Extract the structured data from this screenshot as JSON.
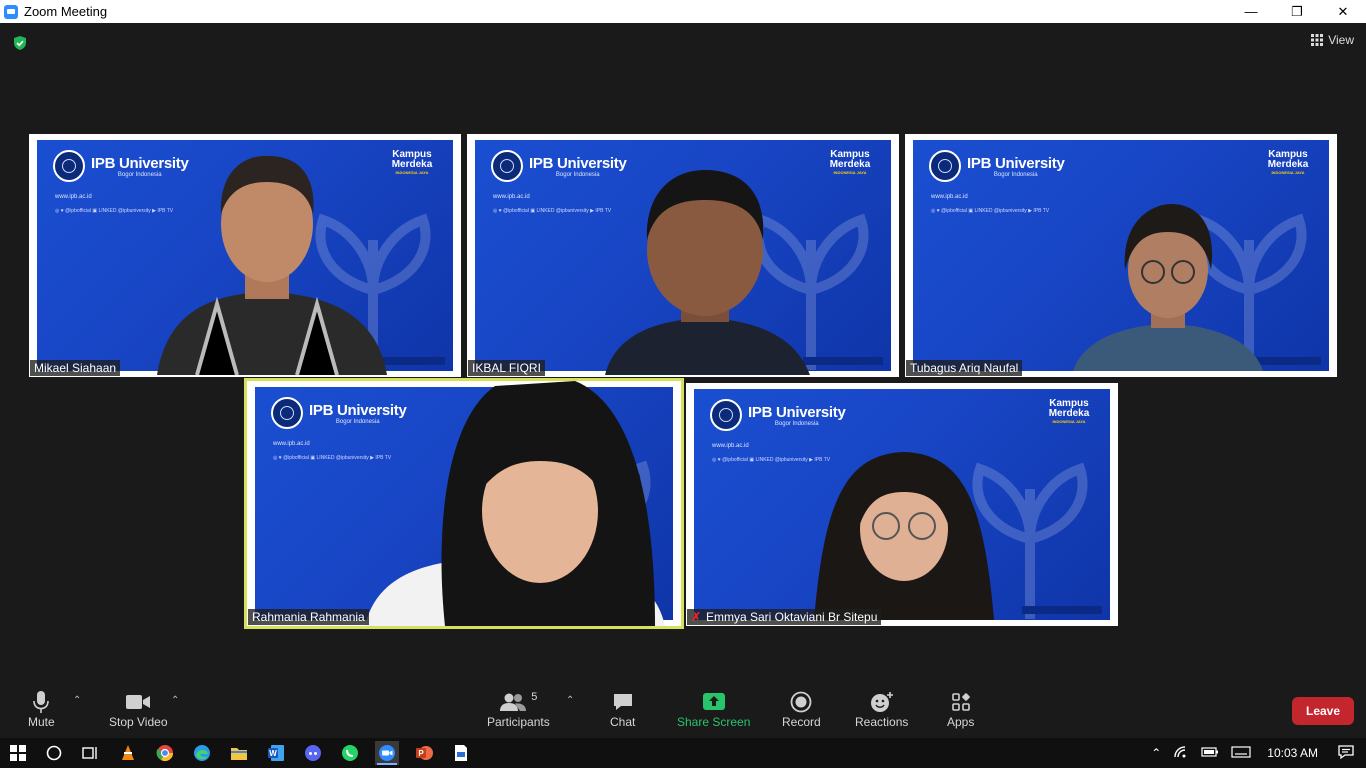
{
  "window": {
    "title": "Zoom Meeting",
    "minimize": "—",
    "restore": "❐",
    "close": "✕"
  },
  "header": {
    "view_label": "View"
  },
  "banner": {
    "university": "IPB University",
    "location": "Bogor Indonesia",
    "website": "www.ipb.ac.id",
    "socials": "◎ ♥ @ipbofficial   ▣ LINKED   @ipbuniversity   ▶ IPB TV",
    "kampus_line1": "Kampus",
    "kampus_line2": "Merdeka",
    "kampus_sub": "INDONESIA JAYA"
  },
  "participants": [
    {
      "name": "Mikael Siahaan",
      "muted": false,
      "active": false
    },
    {
      "name": "IKBAL FIQRI",
      "muted": false,
      "active": false
    },
    {
      "name": "Tubagus Ariq Naufal",
      "muted": false,
      "active": false
    },
    {
      "name": "Rahmania Rahmania",
      "muted": false,
      "active": true
    },
    {
      "name": "Emmya Sari Oktaviani Br Sitepu",
      "muted": true,
      "active": false
    }
  ],
  "toolbar": {
    "mute": "Mute",
    "stop_video": "Stop Video",
    "participants": "Participants",
    "participants_count": "5",
    "chat": "Chat",
    "share_screen": "Share Screen",
    "record": "Record",
    "reactions": "Reactions",
    "apps": "Apps",
    "leave": "Leave"
  },
  "taskbar": {
    "time": "10:03 AM"
  },
  "colors": {
    "accent": "#2d8cff",
    "share": "#27c46c",
    "leave": "#c4262e",
    "active_border": "#d6e05a",
    "banner_blue": "#1a4fd1"
  }
}
